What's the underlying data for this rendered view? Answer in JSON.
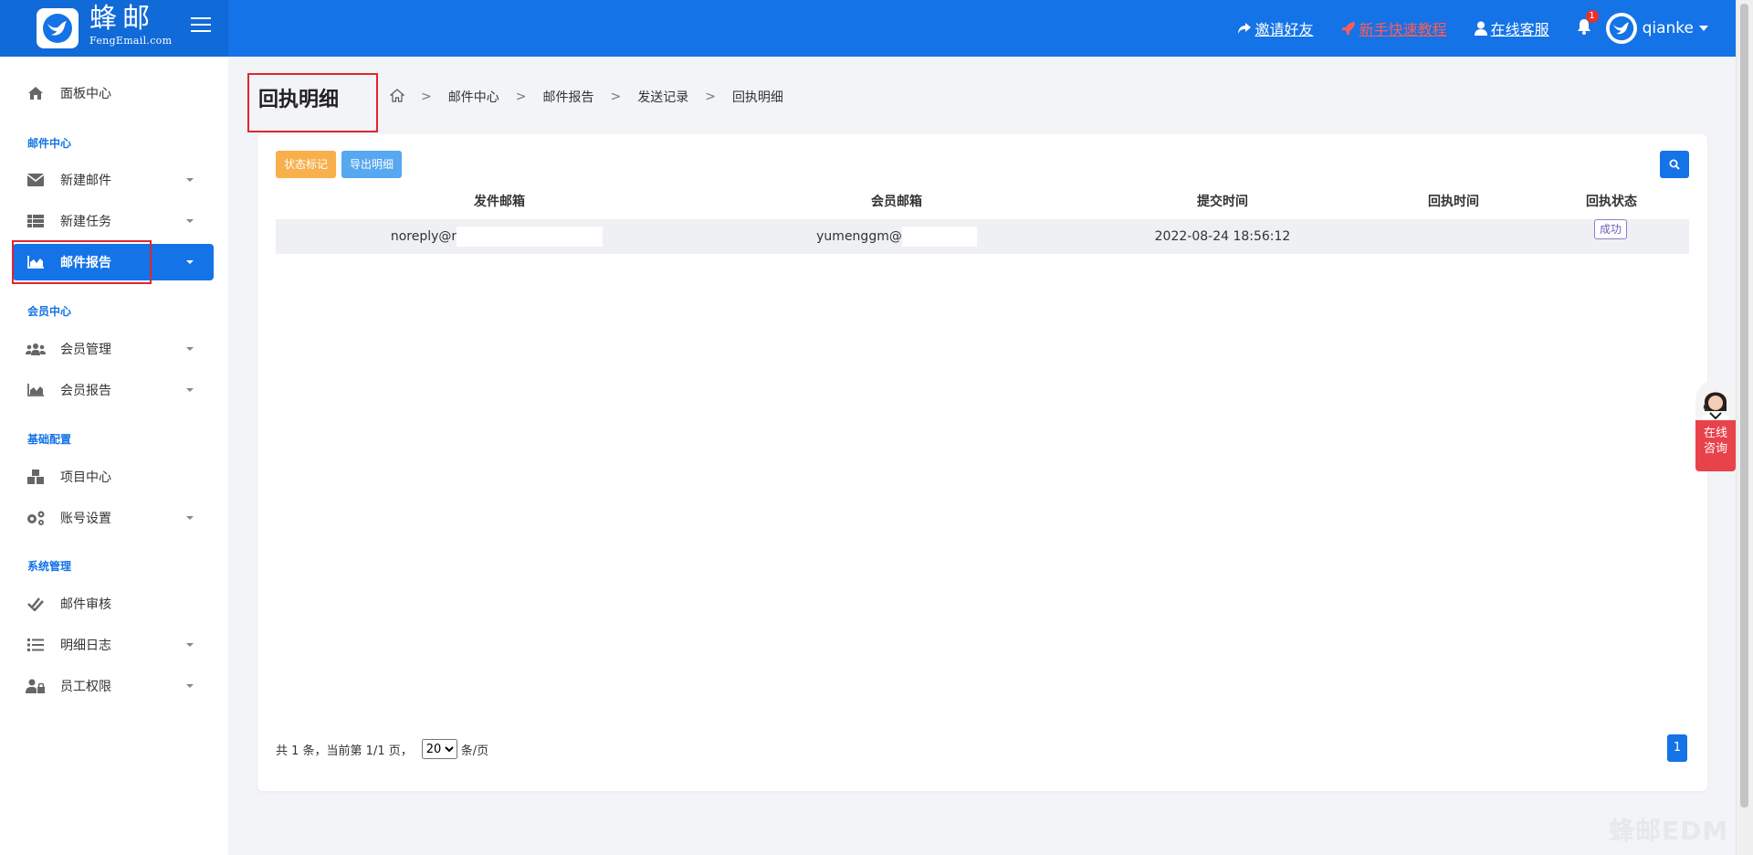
{
  "brand": {
    "name_cn": "蜂邮",
    "name_en": "FengEmail.com"
  },
  "topbar": {
    "invite": "邀请好友",
    "tutorial": "新手快速教程",
    "support": "在线客服",
    "notification_count": "1",
    "username": "qianke"
  },
  "sidebar": {
    "dashboard": "面板中心",
    "section_mail": "邮件中心",
    "new_mail": "新建邮件",
    "new_task": "新建任务",
    "mail_report": "邮件报告",
    "section_member": "会员中心",
    "member_manage": "会员管理",
    "member_report": "会员报告",
    "section_basic": "基础配置",
    "project_center": "项目中心",
    "account_settings": "账号设置",
    "section_system": "系统管理",
    "mail_review": "邮件审核",
    "detail_log": "明细日志",
    "staff_permission": "员工权限"
  },
  "page": {
    "title": "回执明细",
    "breadcrumb": [
      "邮件中心",
      "邮件报告",
      "发送记录",
      "回执明细"
    ]
  },
  "toolbar": {
    "status_mark": "状态标记",
    "export_detail": "导出明细"
  },
  "table": {
    "columns": [
      "发件邮箱",
      "会员邮箱",
      "提交时间",
      "回执时间",
      "回执状态"
    ],
    "rows": [
      {
        "sender": "noreply@r",
        "member": "yumenggm@",
        "submit_time": "2022-08-24 18:56:12",
        "receipt_time": "",
        "status": "成功"
      }
    ]
  },
  "pager": {
    "summary": "共 1 条，当前第 1/1 页，",
    "page_size": "20",
    "per_page_suffix": "条/页",
    "current_page": "1"
  },
  "consult": {
    "label_line1": "在线",
    "label_line2": "咨询"
  },
  "watermark": "蜂邮EDM",
  "colors": {
    "primary": "#1473e6",
    "orange_button": "#f7b04b",
    "light_blue_button": "#56a8f0",
    "highlight_border": "#e0262f",
    "tutorial_link": "#ff5b5b"
  }
}
